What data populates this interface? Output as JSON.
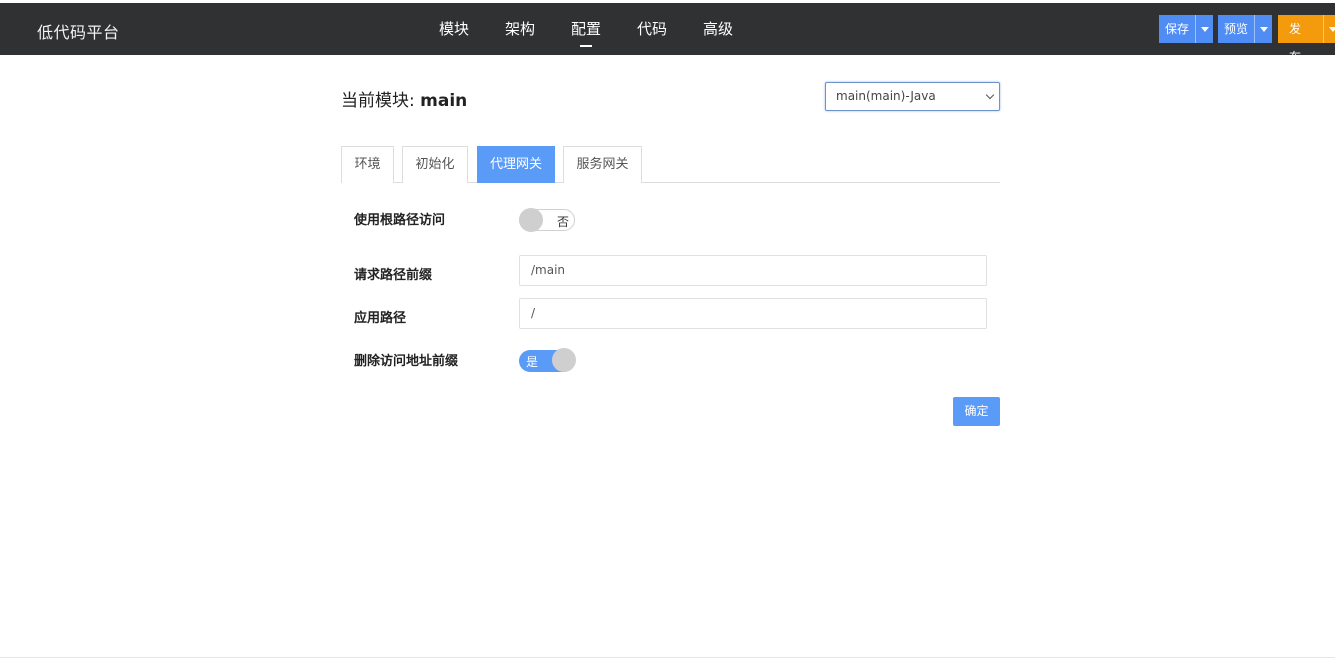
{
  "header": {
    "brand": "低代码平台",
    "nav": [
      "模块",
      "架构",
      "配置",
      "代码",
      "高级"
    ],
    "active_nav_index": 2,
    "buttons": {
      "save": "保存",
      "preview": "预览",
      "publish": "发布"
    },
    "colors": {
      "background": "#2f3133",
      "save": "#4f8df5",
      "preview": "#4f8df5",
      "publish": "#f39b0c"
    }
  },
  "module": {
    "title_prefix": "当前模块:",
    "title_name": "main",
    "select_value": "main(main)-Java"
  },
  "tabs": [
    "环境",
    "初始化",
    "代理网关",
    "服务网关"
  ],
  "active_tab_index": 2,
  "form": {
    "use_root_path": {
      "label": "使用根路径访问",
      "value": "否",
      "checked": false
    },
    "request_path_prefix": {
      "label": "请求路径前缀",
      "value": "/main"
    },
    "app_path": {
      "label": "应用路径",
      "value": "/"
    },
    "strip_prefix": {
      "label": "删除访问地址前缀",
      "value": "是",
      "checked": true
    },
    "confirm": "确定"
  },
  "accent_color": "#5b9bf8"
}
